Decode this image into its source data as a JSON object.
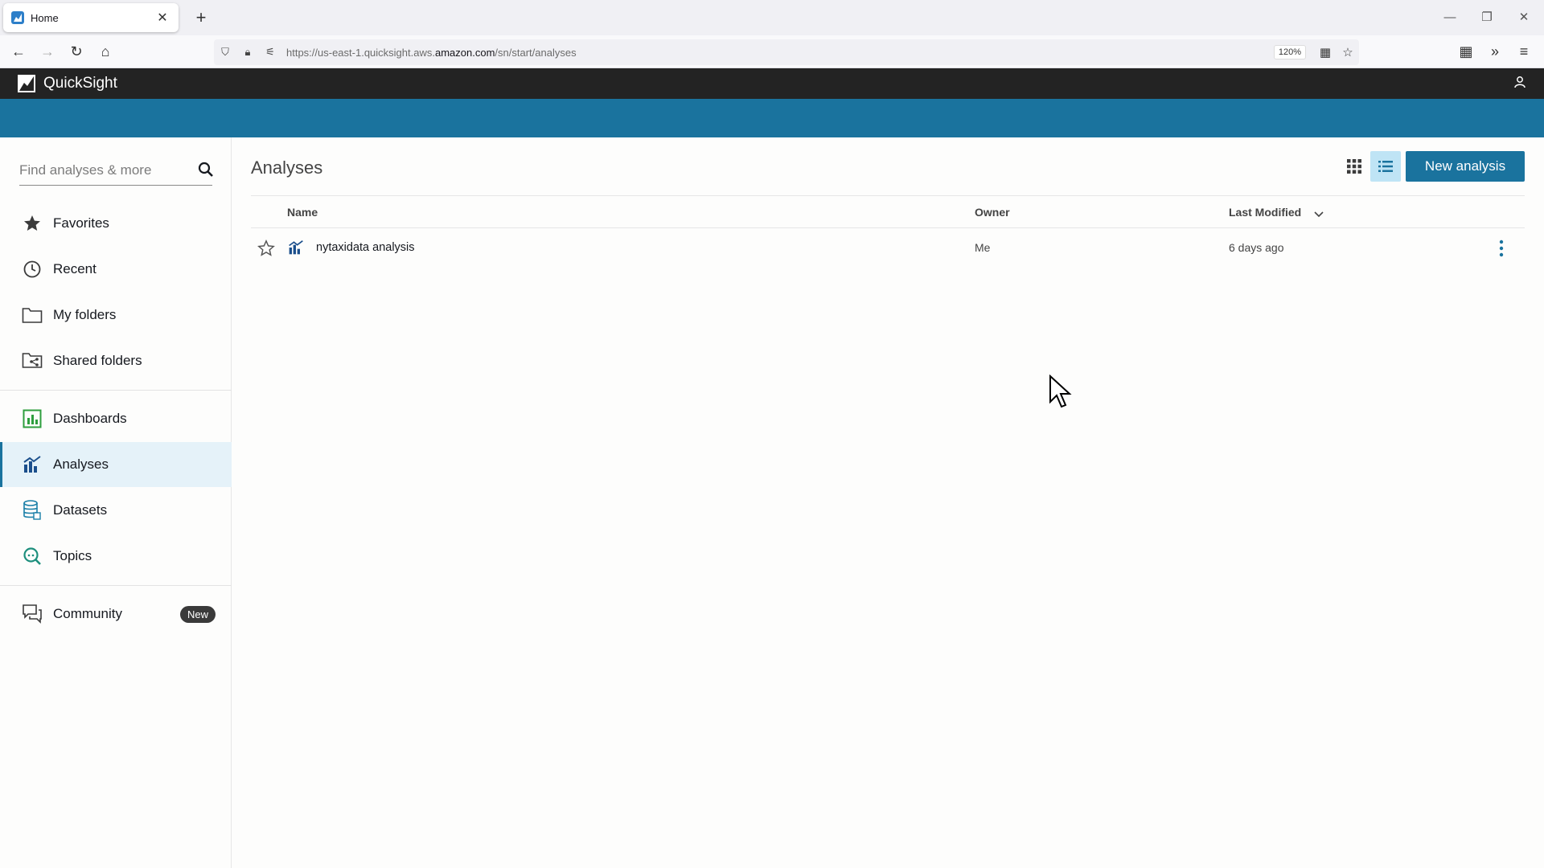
{
  "browser": {
    "tab_title": "Home",
    "url_prefix": "https://us-east-1.quicksight.aws.",
    "url_domain": "amazon.com",
    "url_path": "/sn/start/analyses",
    "zoom": "120%"
  },
  "app": {
    "name": "QuickSight"
  },
  "search": {
    "placeholder": "Find analyses & more"
  },
  "sidebar": {
    "items": [
      {
        "label": "Favorites",
        "icon": "star-icon"
      },
      {
        "label": "Recent",
        "icon": "clock-icon"
      },
      {
        "label": "My folders",
        "icon": "folder-icon"
      },
      {
        "label": "Shared folders",
        "icon": "shared-folder-icon"
      },
      {
        "label": "Dashboards",
        "icon": "dashboard-icon"
      },
      {
        "label": "Analyses",
        "icon": "analysis-icon",
        "active": true
      },
      {
        "label": "Datasets",
        "icon": "dataset-icon"
      },
      {
        "label": "Topics",
        "icon": "topics-icon"
      },
      {
        "label": "Community",
        "icon": "community-icon",
        "badge": "New"
      }
    ]
  },
  "main": {
    "title": "Analyses",
    "new_button": "New analysis",
    "columns": {
      "name": "Name",
      "owner": "Owner",
      "last_modified": "Last Modified"
    },
    "rows": [
      {
        "name": "nytaxidata analysis",
        "owner": "Me",
        "last_modified": "6 days ago"
      }
    ]
  },
  "colors": {
    "header_bg": "#232323",
    "banner": "#1a739e",
    "accent": "#1a739e",
    "active_bg": "#e5f2f9"
  }
}
